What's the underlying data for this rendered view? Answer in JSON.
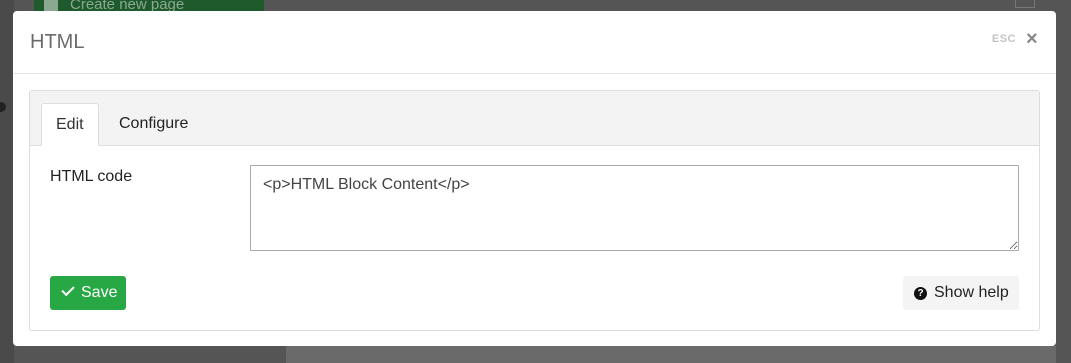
{
  "background": {
    "create_page_label": "Create new page"
  },
  "modal": {
    "title": "HTML",
    "esc_label": "ESC",
    "close_symbol": "×",
    "tabs": [
      {
        "label": "Edit",
        "active": true
      },
      {
        "label": "Configure",
        "active": false
      }
    ],
    "html_field": {
      "label": "HTML code",
      "value": "<p>HTML Block Content</p>"
    },
    "save_button": {
      "label": "Save",
      "icon": "check-icon",
      "color": "#28a745"
    },
    "help_button": {
      "label": "Show help",
      "icon": "question-circle-icon"
    }
  }
}
